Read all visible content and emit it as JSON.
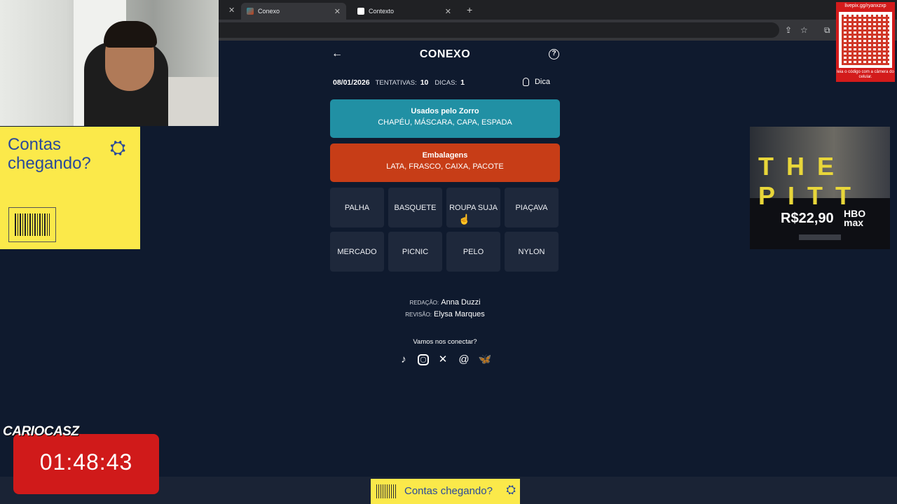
{
  "browser": {
    "tabs": [
      {
        "label": "Conexo",
        "active": true
      },
      {
        "label": "Contexto",
        "active": false
      }
    ]
  },
  "game": {
    "title": "CONEXO",
    "date": "08/01/2026",
    "attempts_label": "TENTATIVAS:",
    "attempts": "10",
    "hints_label": "DICAS:",
    "hints": "1",
    "hint_button": "Dica",
    "solved_groups": [
      {
        "name": "Usados pelo Zorro",
        "words": "CHAPÉU, MÁSCARA, CAPA, ESPADA",
        "color": "#2190a4"
      },
      {
        "name": "Embalagens",
        "words": "LATA, FRASCO, CAIXA, PACOTE",
        "color": "#c73d17"
      }
    ],
    "words": [
      "PALHA",
      "BASQUETE",
      "ROUPA SUJA",
      "PIAÇAVA",
      "MERCADO",
      "PICNIC",
      "PELO",
      "NYLON"
    ]
  },
  "credits": {
    "redacao_label": "REDAÇÃO:",
    "redacao": "Anna Duzzi",
    "revisao_label": "REVISÃO:",
    "revisao": "Elysa Marques",
    "connect": "Vamos nos conectar?"
  },
  "socials": [
    "tiktok-icon",
    "instagram-icon",
    "x-icon",
    "threads-icon",
    "bluesky-icon"
  ],
  "overlays": {
    "ad_left_text": "Contas chegando?",
    "ad_bottom_text": "Contas chegando?",
    "ad_right_title": "THE PITT",
    "ad_right_price": "R$22,90",
    "ad_right_brand": "HBO max",
    "qr_url": "livepix.gg/ryanxzxp",
    "qr_caption": "leia o código com a câmera do celular.",
    "streamer_logo": "CARIOCASZ",
    "timer": "01:48:43"
  }
}
